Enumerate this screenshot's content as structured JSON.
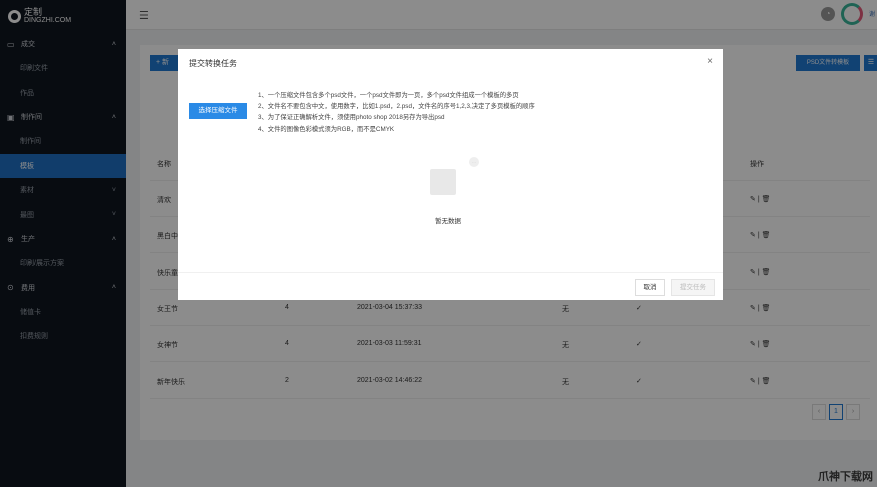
{
  "sidebar": {
    "logo_cn": "定制",
    "logo_en": "DINGZHI.COM",
    "groups": [
      {
        "label": "成交",
        "items": [
          "印刷文件",
          "作品"
        ]
      },
      {
        "label": "制作间",
        "items": [
          "制作间",
          "模板",
          "素材",
          "最图"
        ]
      },
      {
        "label": "生产",
        "items": [
          "印刷/展示方案"
        ]
      },
      {
        "label": "费用",
        "items": [
          "储值卡",
          "扣费规则"
        ]
      }
    ]
  },
  "header": {
    "user": "谢"
  },
  "toolbar": {
    "add": "+ 新",
    "psd": "PSD文件转模板",
    "more": "☰"
  },
  "table": {
    "headers": [
      "名称",
      "",
      "",
      "",
      "",
      "操作"
    ],
    "rows": [
      [
        "清欢",
        "",
        "",
        "",
        "",
        ""
      ],
      [
        "黑白中",
        "",
        "",
        "",
        "",
        ""
      ],
      [
        "快乐童",
        "",
        "",
        "",
        "",
        ""
      ],
      [
        "女王节",
        "4",
        "2021-03-04 15:37:33",
        "无",
        "✓",
        ""
      ],
      [
        "女神节",
        "4",
        "2021-03-03 11:59:31",
        "无",
        "✓",
        ""
      ],
      [
        "新年快乐",
        "2",
        "2021-03-02 14:46:22",
        "无",
        "✓",
        ""
      ]
    ]
  },
  "pagination": {
    "prev": "‹",
    "current": "1",
    "next": "›"
  },
  "modal": {
    "title": "提交转换任务",
    "close": "×",
    "select_button": "选择压缩文件",
    "rules": [
      "1、一个压缩文件包含多个psd文件，一个psd文件即为一页，多个psd文件组成一个模板的多页",
      "2、文件名不要包含中文，使用数字，比如1.psd，2.psd，文件名的序号1,2,3,决定了多页模板的顺序",
      "3、为了保证正确解析文件，须使用photo shop 2018另存为导出psd",
      "4、文件的图像色彩模式须为RGB，而不是CMYK"
    ],
    "empty_text": "暂无数据",
    "cancel": "取消",
    "submit": "提交任务"
  },
  "watermark": "爪神下载网"
}
